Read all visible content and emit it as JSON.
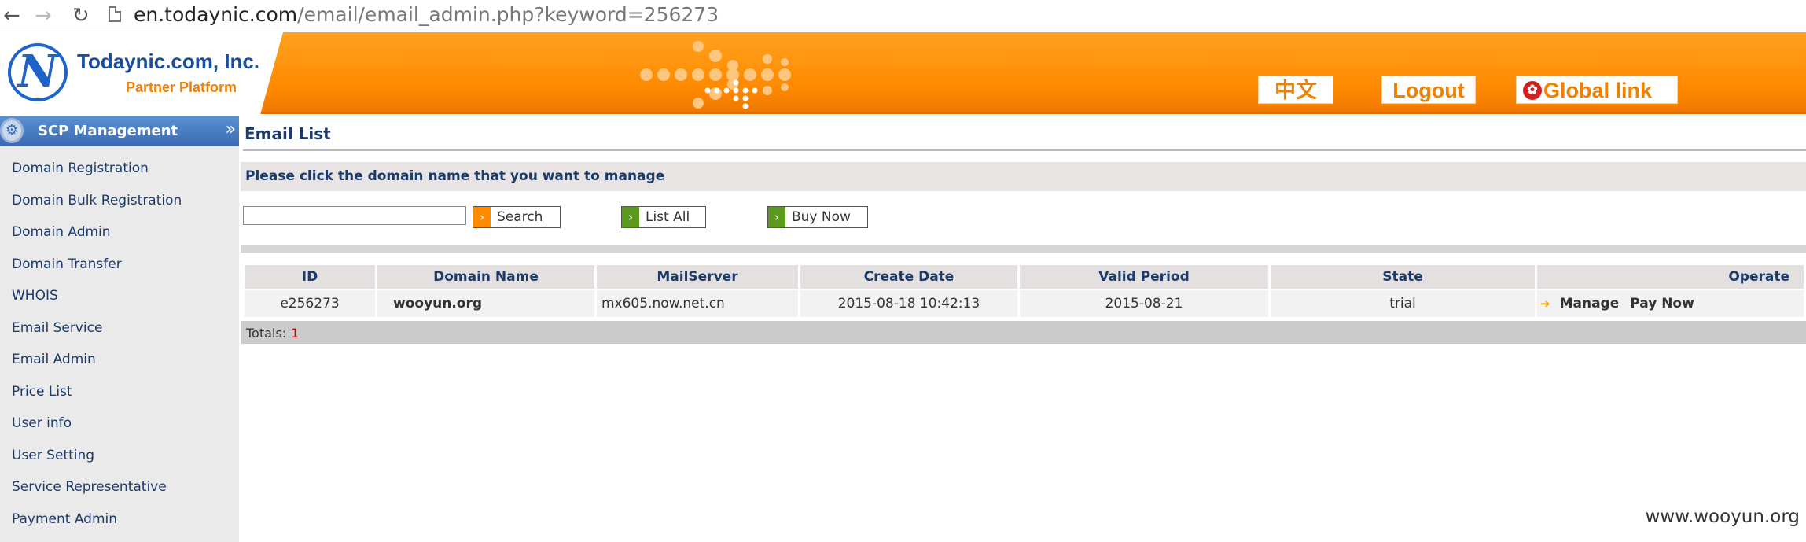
{
  "browser": {
    "back_icon": "arrow-left",
    "forward_icon": "arrow-right",
    "reload_icon": "reload",
    "url_host": "en.todaynic.com",
    "url_path": "/email/email_admin.php?keyword=256273"
  },
  "header": {
    "logo_letter": "N",
    "company": "Todaynic.com, Inc.",
    "platform": "Partner Platform",
    "lang_label": "中文",
    "logout_label": "Logout",
    "global_label": "Global link"
  },
  "sidebar": {
    "title": "SCP Management",
    "items": [
      {
        "label": "Domain Registration"
      },
      {
        "label": "Domain Bulk Registration"
      },
      {
        "label": "Domain Admin"
      },
      {
        "label": "Domain Transfer"
      },
      {
        "label": "WHOIS"
      },
      {
        "label": "Email Service"
      },
      {
        "label": "Email Admin"
      },
      {
        "label": "Price List"
      },
      {
        "label": "User info"
      },
      {
        "label": "User Setting"
      },
      {
        "label": "Service Representative"
      },
      {
        "label": "Payment Admin"
      }
    ]
  },
  "main": {
    "title": "Email List",
    "instruction": "Please click the domain name that you want to manage",
    "search_value": "",
    "search_label": "Search",
    "list_all_label": "List All",
    "buy_now_label": "Buy Now",
    "table": {
      "headers": [
        "ID",
        "Domain Name",
        "MailServer",
        "Create Date",
        "Valid Period",
        "State",
        "Operate"
      ],
      "rows": [
        {
          "id": "e256273",
          "domain": "wooyun.org",
          "mailserver": "mx605.now.net.cn",
          "create_date": "2015-08-18 10:42:13",
          "valid_period": "2015-08-21",
          "state": "trial",
          "manage_label": "Manage",
          "pay_label": "Pay Now"
        }
      ]
    },
    "totals_label": "Totals:",
    "totals_count": "1"
  },
  "watermark": "www.wooyun.org",
  "colors": {
    "header_orange": "#ff8a00",
    "sidebar_head_blue": "#3a6cb4",
    "nav_text": "#1c3a6a",
    "button_green": "#5b9a1e"
  }
}
